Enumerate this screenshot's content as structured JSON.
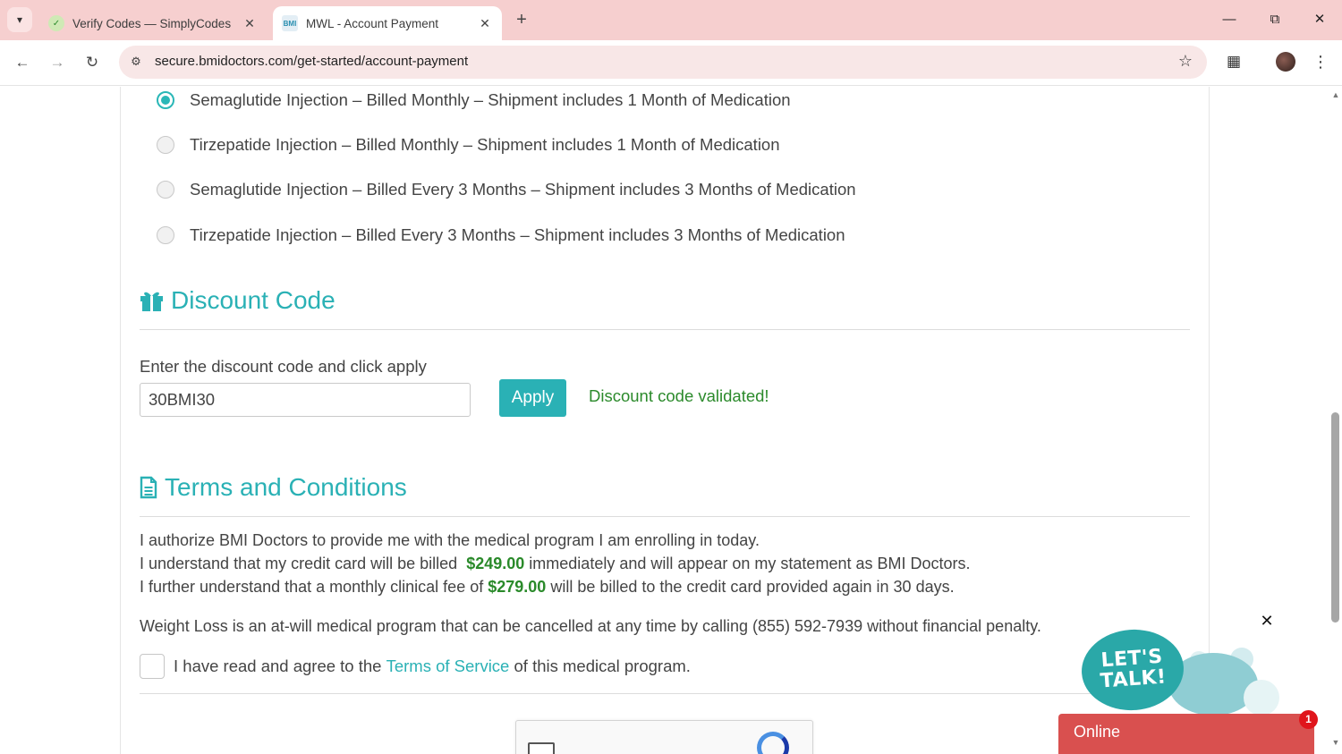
{
  "browser": {
    "tabs": [
      {
        "title": "Verify Codes — SimplyCodes",
        "favicon": "simplycodes-icon",
        "active": false
      },
      {
        "title": "MWL - Account Payment",
        "favicon": "bmi-doctors-icon",
        "active": true
      }
    ],
    "url": "secure.bmidoctors.com/get-started/account-payment"
  },
  "plans": [
    {
      "label": "Semaglutide Injection – Billed Monthly – Shipment includes 1 Month of Medication",
      "selected": true
    },
    {
      "label": "Tirzepatide Injection – Billed Monthly – Shipment includes 1 Month of Medication",
      "selected": false
    },
    {
      "label": "Semaglutide Injection – Billed Every 3 Months – Shipment includes 3 Months of Medication",
      "selected": false
    },
    {
      "label": "Tirzepatide Injection – Billed Every 3 Months – Shipment includes 3 Months of Medication",
      "selected": false
    }
  ],
  "discount": {
    "heading": "Discount Code",
    "label": "Enter the discount code and click apply",
    "code": "30BMI30",
    "apply_label": "Apply",
    "status": "Discount code validated!"
  },
  "terms": {
    "heading": "Terms and Conditions",
    "line1": "I authorize BMI Doctors to provide me with the medical program I am enrolling in today.",
    "line2_pre": "I understand that my credit card will be billed",
    "line2_amount": "$249.00",
    "line2_post": "immediately and will appear on my statement as BMI Doctors.",
    "line3_pre": "I further understand that a monthly clinical fee of",
    "line3_amount": "$279.00",
    "line3_post": "will be billed to the credit card provided again in 30 days.",
    "cancel_note": "Weight Loss is an at-will medical program that can be cancelled at any time by calling (855) 592-7939 without financial penalty.",
    "agree_pre": "I have read and agree to the",
    "agree_link": "Terms of Service",
    "agree_post": "of this medical program."
  },
  "chat": {
    "bubble_line1": "LET'S",
    "bubble_line2": "TALK!",
    "status": "Online",
    "badge_count": "1"
  },
  "colors": {
    "accent": "#2ab1b5",
    "success": "#2b8a2b",
    "chat_bar": "#d9504f",
    "tab_strip": "#f6cfcf"
  }
}
